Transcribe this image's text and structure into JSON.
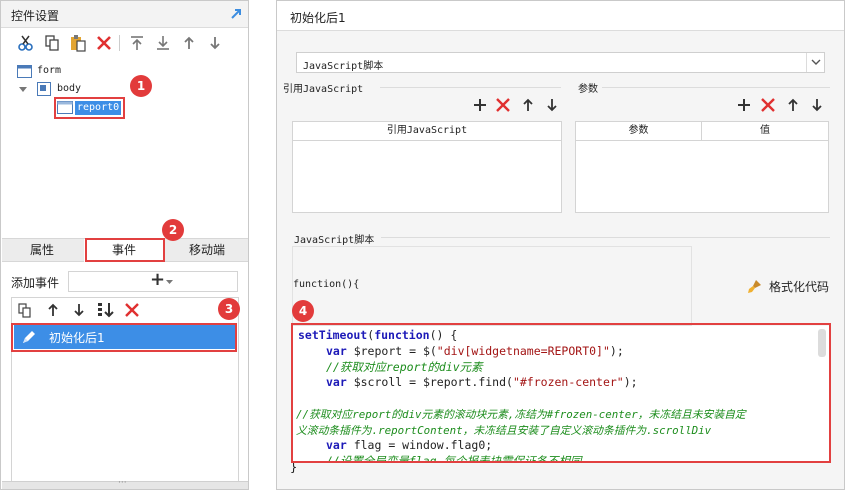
{
  "left_panel": {
    "title": "控件设置",
    "toolbar_icons": [
      "cut-icon",
      "copy-icon",
      "paste-icon",
      "delete-icon",
      "move-top-icon",
      "move-bottom-icon",
      "move-up-icon",
      "move-down-icon"
    ],
    "tree": {
      "form": "form",
      "body": "body",
      "report": "report0"
    },
    "tabs": {
      "properties": "属性",
      "events": "事件",
      "mobile": "移动端"
    },
    "add_event_label": "添加事件",
    "add_event_button": "+",
    "event_items": [
      {
        "label": "初始化后1"
      }
    ]
  },
  "annotations": {
    "badge1": "1",
    "badge2": "2",
    "badge3": "3",
    "badge4": "4"
  },
  "right_panel": {
    "title": "初始化后1",
    "script_type_select": "JavaScript脚本",
    "ref_js_section_title": "引用JavaScript",
    "ref_js_column": "引用JavaScript",
    "params_section_title": "参数",
    "params_columns": {
      "name": "参数",
      "value": "值"
    },
    "script_section_title": "JavaScript脚本",
    "function_signature": "function(){",
    "format_code_button": "格式化代码",
    "closing_brace": "}",
    "code": {
      "line1_kw": "setTimeout",
      "line1_rest": "(",
      "line1_fn": "function",
      "line1_tail": "() {",
      "line2_kw": "var",
      "line2_mid": " $report = $(",
      "line2_str": "\"div[widgetname=REPORT0]\"",
      "line2_tail": ");",
      "line3_cm": "//获取对应report的div元素",
      "line4_kw": "var",
      "line4_mid": " $scroll = $report.find(",
      "line4_str": "\"#frozen-center\"",
      "line4_tail": ");",
      "line6_cm": "//获取对应report的div元素的滚动块元素,冻结为#frozen-center，未冻结且未安装自定",
      "line7_cm": "义滚动条插件为.reportContent，未冻结且安装了自定义滚动条插件为.scrollDiv",
      "line8_kw": "var",
      "line8_mid": " flag = window.flag0;",
      "line9_cm": "//设置全局变量flag,每个报表块需保证各不相同"
    }
  },
  "colors": {
    "accent_blue": "#3c8de0",
    "delete_red": "#e03030",
    "annotation_red": "#e23b3b",
    "selected_row": "#3d8ee6"
  }
}
